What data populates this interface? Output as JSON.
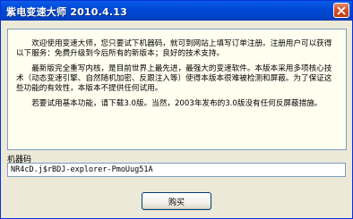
{
  "window": {
    "title": "紫电变速大师  2010.4.13",
    "close_icon": "close-icon"
  },
  "message": {
    "paragraphs": [
      "欢迎使用变速大师，您只要试下机器码，就可到网站上填写订单注册。注册用户可以获得以下服务：免费升级到今后所有的新版本；良好的技术支持。",
      "最新版完全重写内核，是目前世界上最先进，最强大的变速软件。本版本采用多项核心技术（动态变速引擎、自然随机加密、反跟注入等）使得本版本很难被检测和屏蔽。为了保证这些功能的有效性，本版本不提供任何试用。",
      "若要试用基本功能，请下载3.0版。当然，2003年发布的3.0版没有任何反屏蔽措施。"
    ]
  },
  "machine_code": {
    "label": "机器码",
    "value": "NR4cD.j$rBDJ-explorer-PmoUug51A"
  },
  "buttons": {
    "buy_label": "购买"
  }
}
